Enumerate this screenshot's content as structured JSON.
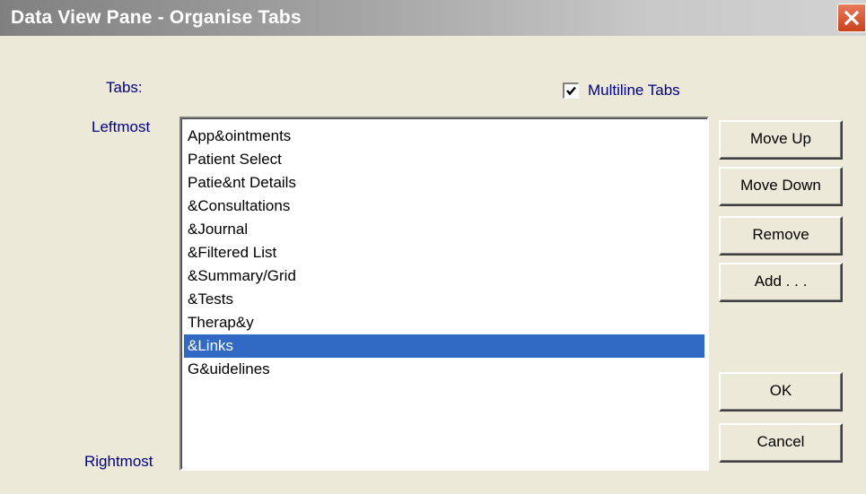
{
  "window": {
    "title": "Data View Pane - Organise Tabs"
  },
  "labels": {
    "tabs": "Tabs:",
    "leftmost": "Leftmost",
    "rightmost": "Rightmost"
  },
  "multiline": {
    "label": "Multiline Tabs",
    "checked": true
  },
  "tab_list": {
    "items": [
      "App&ointments",
      "Patient Select",
      "Patie&nt Details",
      "&Consultations",
      "&Journal",
      "&Filtered List",
      "&Summary/Grid",
      "&Tests",
      "Therap&y",
      "&Links",
      "G&uidelines"
    ],
    "selected_index": 9
  },
  "buttons": {
    "move_up": "Move Up",
    "move_down": "Move Down",
    "remove": "Remove",
    "add": "Add . . .",
    "ok": "OK",
    "cancel": "Cancel"
  },
  "colors": {
    "selection": "#316ac5",
    "label_text": "#000080",
    "face": "#ece9d8"
  }
}
